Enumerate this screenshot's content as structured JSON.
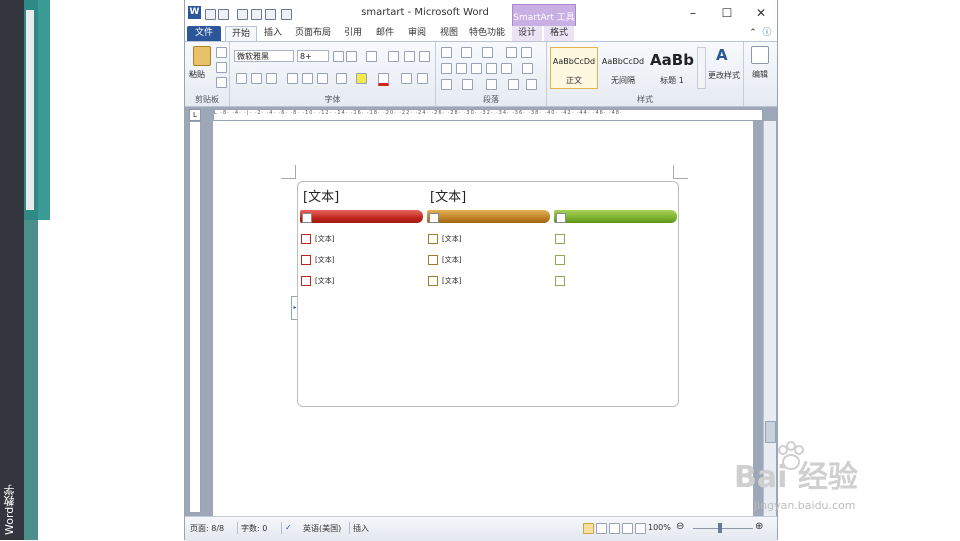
{
  "side_title": "Word教学",
  "window": {
    "title": "smartart - Microsoft Word",
    "contextual_tab": "SmartArt 工具"
  },
  "tabs": [
    "文件",
    "开始",
    "插入",
    "页面布局",
    "引用",
    "邮件",
    "审阅",
    "视图",
    "特色功能",
    "设计",
    "格式"
  ],
  "ribbon": {
    "clipboard": {
      "paste": "粘贴",
      "label": "剪贴板"
    },
    "font": {
      "name": "微软雅黑",
      "size": "8+",
      "label": "字体"
    },
    "paragraph": {
      "label": "段落"
    },
    "styles": {
      "label": "样式",
      "items": [
        {
          "sample": "AaBbCcDd",
          "name": "正文"
        },
        {
          "sample": "AaBbCcDd",
          "name": "无间隔"
        },
        {
          "sample": "AaBb",
          "name": "标题 1"
        }
      ],
      "change_styles": "更改样式"
    },
    "editing": {
      "label": "编辑"
    }
  },
  "ruler": "L  ·8·  ·4·  ·|·  ·2·  ·4·  ·6·  ·8·  ·10·  ·12·  ·14·  ·16·  ·18·  ·20·  ·22·  ·24·  ·26·  ·28·  ·30·  ·32·  ·34·  ·36·  ·38·  ·40·  ·42·  ·44·  ·46·  ·48·",
  "smartart": {
    "headers": [
      "[文本]",
      "[文本]",
      ""
    ],
    "columns": [
      {
        "color": "red",
        "items": [
          "[文本]",
          "[文本]",
          "[文本]"
        ]
      },
      {
        "color": "orange",
        "items": [
          "[文本]",
          "[文本]",
          "[文本]"
        ]
      },
      {
        "color": "green",
        "items": [
          "",
          "",
          ""
        ]
      }
    ]
  },
  "status": {
    "page": "页面: 8/8",
    "words": "字数: 0",
    "language": "英语(美国)",
    "mode": "插入",
    "zoom": "100%"
  },
  "watermark": {
    "main": "Bai 经验",
    "sub": "jingyan.baidu.com"
  }
}
